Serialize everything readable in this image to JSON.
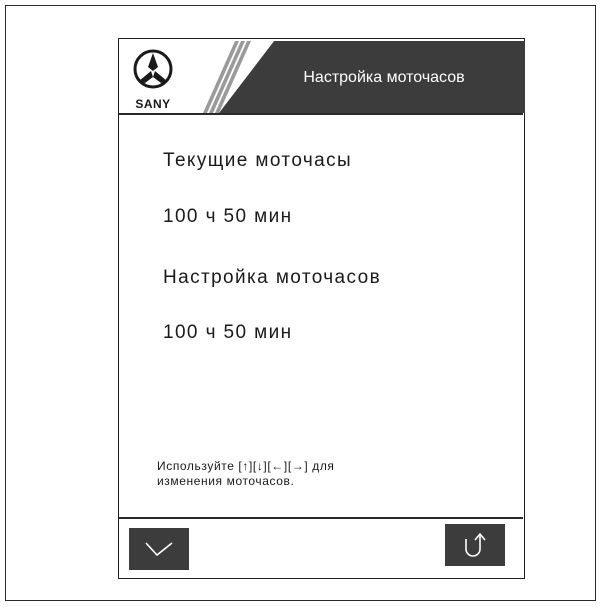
{
  "header": {
    "logo_text": "SANY",
    "title": "Настройка моточасов"
  },
  "current": {
    "label": "Текущие моточасы",
    "value": "100 ч 50 мин"
  },
  "setting": {
    "label": "Настройка моточасов",
    "value": "100 ч 50 мин"
  },
  "hint": {
    "line1": "Используйте [↑][↓][←][→] для",
    "line2": "изменения моточасов."
  },
  "softkeys": {
    "confirm_icon": "check-icon",
    "back_icon": "return-arrow-icon"
  },
  "colors": {
    "header_bar": "#3c3c3c",
    "softkey": "#3c3c3c",
    "text": "#1a1a1a"
  }
}
